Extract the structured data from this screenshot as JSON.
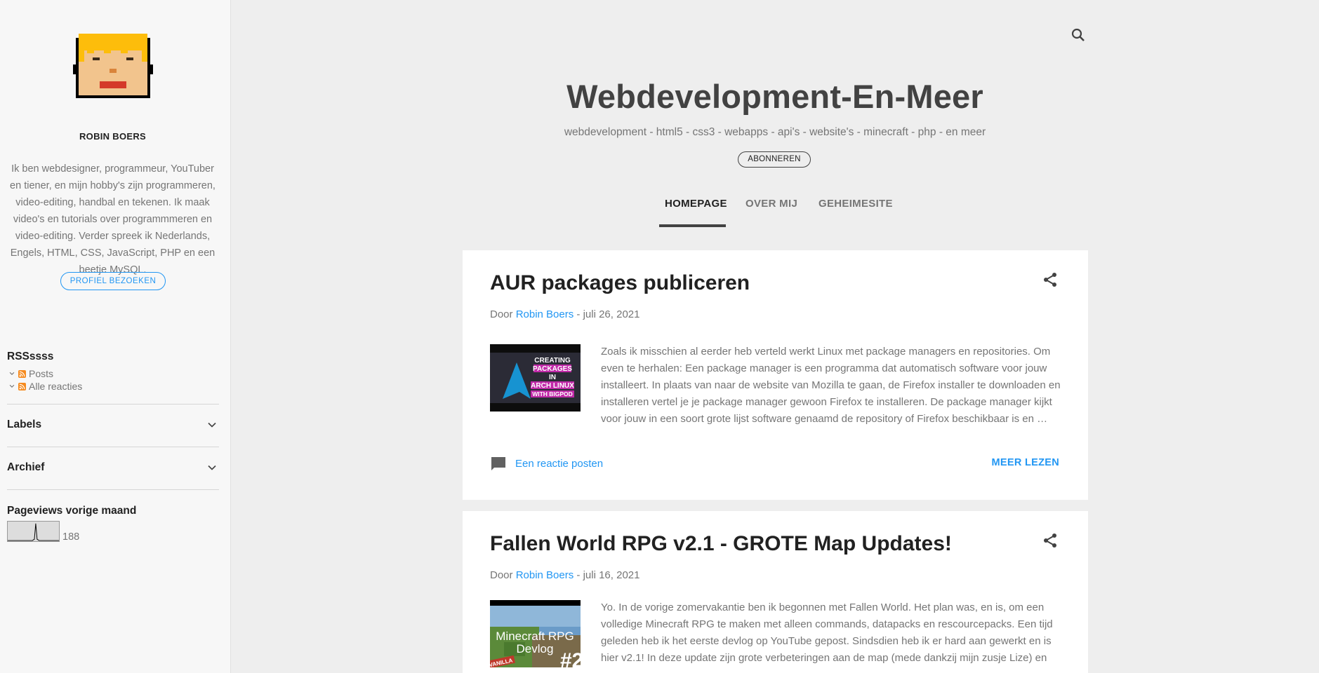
{
  "sidebar": {
    "profile_name": "ROBIN BOERS",
    "profile_description": "Ik ben webdesigner, programmeur, YouTuber en tiener, en mijn hobby's zijn programmeren, video-editing, handbal en tekenen. Ik maak video's en tutorials over programmmeren en video-editing. Verder spreek ik Nederlands, Engels, HTML, CSS, JavaScript, PHP en een beetje MySQL.",
    "profile_button": "PROFIEL BEZOEKEN",
    "rss_title": "RSSssss",
    "rss_items": [
      "Posts",
      "Alle reacties"
    ],
    "labels_title": "Labels",
    "archive_title": "Archief",
    "pageviews_title": "Pageviews vorige maand",
    "pageviews_count": "188"
  },
  "header": {
    "title": "Webdevelopment-En-Meer",
    "description": "webdevelopment - html5 - css3 - webapps - api's - website's - minecraft - php - en meer",
    "subscribe_button": "ABONNEREN"
  },
  "nav": {
    "tabs": [
      "HOMEPAGE",
      "OVER MIJ",
      "GEHEIMESITE"
    ],
    "active": "HOMEPAGE"
  },
  "posts": [
    {
      "title": "AUR packages publiceren",
      "by": "Door",
      "author": "Robin Boers",
      "date": "- juli 26, 2021",
      "thumbnail_text": [
        "CREATING",
        "PACKAGES",
        "IN",
        "ARCH LINUX",
        "WITH BIGPOD"
      ],
      "snippet": "Zoals ik misschien al eerder heb verteld werkt Linux met package managers en repositories. Om even te herhalen: Een package manager is een programma dat automatisch software voor jouw installeert. In plaats van naar de website van Mozilla te gaan, de Firefox installer te downloaden en installeren vertel je je package manager gewoon Firefox te installeren. De package manager kijkt voor jouw in een soort grote lijst software genaamd de repository of Firefox beschikbaar is en …",
      "comment_link": "Een reactie posten",
      "read_more": "MEER LEZEN"
    },
    {
      "title": "Fallen World RPG v2.1 - GROTE Map Updates!",
      "by": "Door",
      "author": "Robin Boers",
      "date": "- juli 16, 2021",
      "thumbnail_text": [
        "Minecraft RPG",
        "Devlog",
        "#2",
        "VANILLA"
      ],
      "snippet": "Yo. In de vorige zomervakantie ben ik begonnen met Fallen World. Het plan was, en is, om een volledige Minecraft RPG te maken met alleen commands, datapacks en rescourcepacks. Een tijd geleden heb ik het eerste devlog op YouTube gepost. Sindsdien heb ik er hard aan gewerkt en is hier v2.1! In deze update zijn grote verbeteringen aan de map (mede dankzij mijn zusje Lize) en"
    }
  ],
  "colors": {
    "accent": "#2196f3",
    "title": "#424242",
    "muted": "#757575",
    "page_bg": "#eeeeee",
    "sidebar_bg": "#f7f7f7"
  },
  "icons": [
    "search-icon",
    "share-icon",
    "comment-icon",
    "chevron-down-icon",
    "rss-icon"
  ]
}
